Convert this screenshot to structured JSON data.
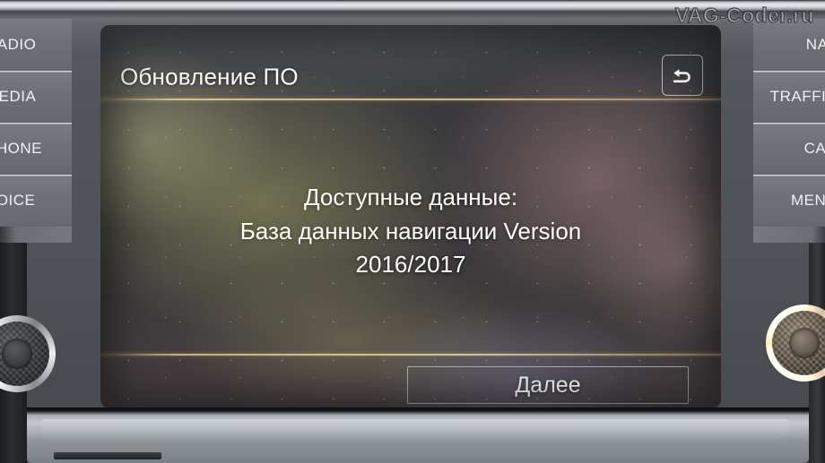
{
  "watermark": {
    "text": "VAG-Coder.ru"
  },
  "hardkeys": {
    "left": [
      {
        "label": "RADIO",
        "name": "hardkey-radio"
      },
      {
        "label": "MEDIA",
        "name": "hardkey-media"
      },
      {
        "label": "PHONE",
        "name": "hardkey-phone"
      },
      {
        "label": "VOICE",
        "name": "hardkey-voice"
      }
    ],
    "right": [
      {
        "label": "NAV",
        "name": "hardkey-nav"
      },
      {
        "label": "TRAFFIC",
        "name": "hardkey-traffic"
      },
      {
        "label": "CAR",
        "name": "hardkey-car"
      },
      {
        "label": "MENU",
        "name": "hardkey-menu"
      }
    ]
  },
  "screen": {
    "title": "Обновление ПО",
    "back_icon": "back-arrow-icon",
    "body_lines": [
      "Доступные данные:",
      "База данных навигации Version",
      "2016/2017"
    ],
    "next_button": "Далее"
  },
  "colors": {
    "screen_text": "#ffffff",
    "divider": "#d6b47c",
    "bezel": "#6e7276",
    "console": "#4e5256"
  }
}
